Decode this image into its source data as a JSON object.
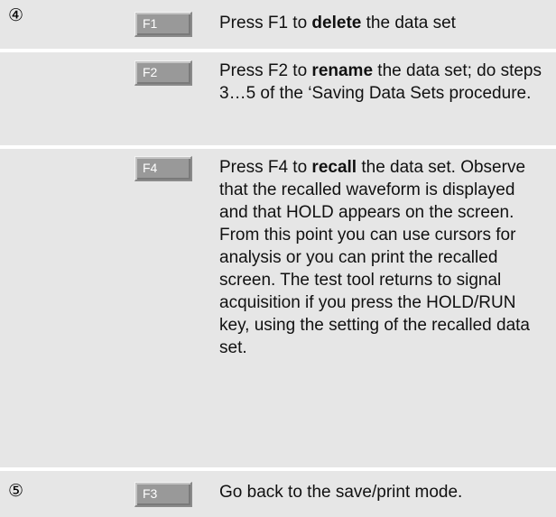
{
  "steps": [
    {
      "number": "④",
      "key": "F1",
      "text_before": "Press F1 to ",
      "emphasis": "delete",
      "text_after": " the data set"
    },
    {
      "number": "",
      "key": "F2",
      "text_before": "Press F2 to ",
      "emphasis": "rename",
      "text_after": " the data set; do steps 3…5 of the ‘Saving Data Sets procedure."
    },
    {
      "number": "",
      "key": "F4",
      "text_before": "Press F4 to ",
      "emphasis": "recall",
      "text_after": " the data set. Observe that the recalled waveform is displayed and that HOLD appears on the screen. From this point you can use cursors for analysis or you can print the recalled screen. The test tool returns to signal acquisition if you press the HOLD/RUN key, using the setting of the recalled data set."
    },
    {
      "number": "⑤",
      "key": "F3",
      "text_before": "Go back to the save/print mode.",
      "emphasis": "",
      "text_after": ""
    }
  ]
}
